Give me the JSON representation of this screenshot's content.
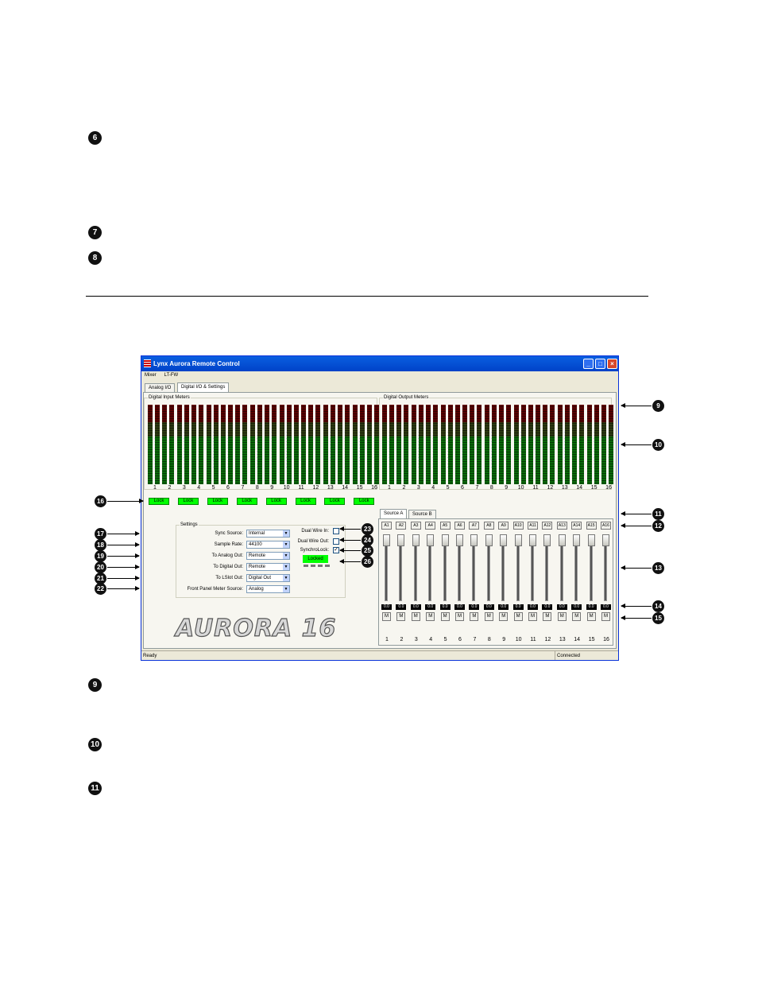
{
  "bullets_top": [
    "6",
    "7",
    "8"
  ],
  "bullets_bottom": [
    "9",
    "10",
    "11"
  ],
  "window": {
    "title": "Lynx Aurora Remote Control",
    "menu": [
      "Mixer",
      "LT-FW"
    ],
    "tabs": [
      "Analog I/O",
      "Digital I/O & Settings"
    ],
    "active_tab": 1,
    "input_meters_label": "Digital Input Meters",
    "output_meters_label": "Digital Output Meters",
    "meter_scale": [
      "0",
      "-1",
      "-2",
      "-3",
      "-4",
      "-5",
      "-6",
      "-8",
      "-10",
      "-12",
      "-14",
      "-16",
      "-18",
      "-20",
      "-22",
      "-24",
      "-26",
      "-30",
      "-36",
      "-42"
    ],
    "channels": [
      "1",
      "2",
      "3",
      "4",
      "5",
      "6",
      "7",
      "8",
      "9",
      "10",
      "11",
      "12",
      "13",
      "14",
      "15",
      "16"
    ],
    "lock_label": "Lock",
    "settings": {
      "group_label": "Settings",
      "rows": [
        {
          "label": "Sync Source:",
          "value": "Internal"
        },
        {
          "label": "Sample Rate:",
          "value": "44100"
        },
        {
          "label": "To Analog Out:",
          "value": "Remote"
        },
        {
          "label": "To Digital Out:",
          "value": "Remote"
        },
        {
          "label": "To LSlot Out:",
          "value": "Digital Out"
        },
        {
          "label": "Front Panel Meter Source:",
          "value": "Analog"
        }
      ],
      "dual_wire_in": "Dual Wire In:",
      "dual_wire_out": "Dual Wire Out:",
      "synchrolock": "SynchroLock:",
      "synchrolock_checked": true,
      "locked_status": "Locked"
    },
    "source_tabs": [
      "Source A",
      "Source B"
    ],
    "source_buttons": [
      "A1",
      "A2",
      "A3",
      "A4",
      "A5",
      "A6",
      "A7",
      "A8",
      "A9",
      "A10",
      "A11",
      "A12",
      "A13",
      "A14",
      "A15",
      "A16"
    ],
    "fader_value": "0.0",
    "mute_label": "M",
    "logo": "AURORA 16",
    "status_left": "Ready",
    "status_right": "Connected"
  },
  "callouts": [
    "9",
    "10",
    "11",
    "12",
    "13",
    "14",
    "15",
    "16",
    "17",
    "18",
    "19",
    "20",
    "21",
    "22",
    "23",
    "24",
    "25",
    "26"
  ]
}
